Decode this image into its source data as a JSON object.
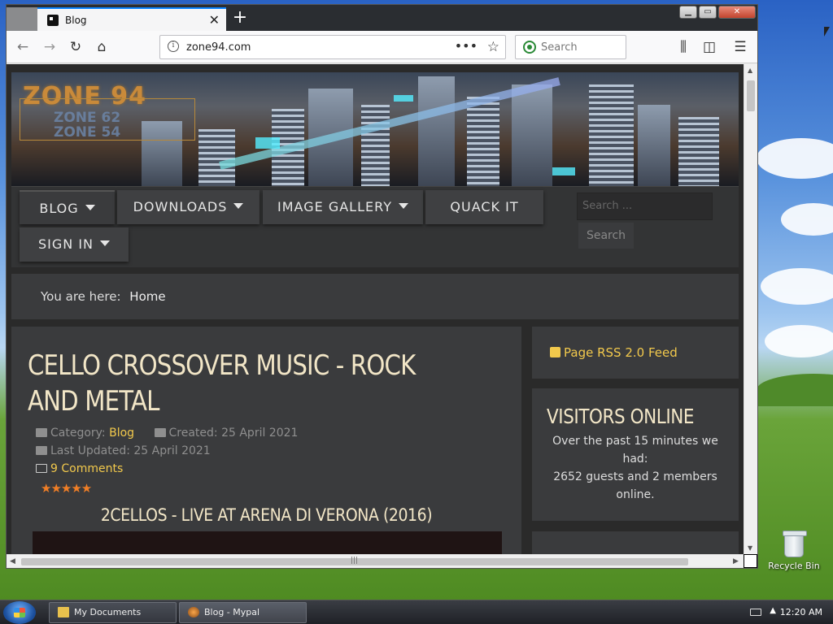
{
  "browser": {
    "tab_title": "Blog",
    "url": "zone94.com",
    "search_placeholder": "Search"
  },
  "site": {
    "logo_main": "ZONE 94",
    "logo_sub1": "ZONE 62",
    "logo_sub2": "ZONE 54",
    "menu": [
      {
        "label": "BLOG"
      },
      {
        "label": "DOWNLOADS"
      },
      {
        "label": "IMAGE GALLERY"
      },
      {
        "label": "QUACK IT"
      },
      {
        "label": "SIGN IN"
      }
    ],
    "search_placeholder": "Search ...",
    "search_button": "Search",
    "breadcrumb_prefix": "You are here:",
    "breadcrumb_home": "Home"
  },
  "article": {
    "title": "CELLO CROSSOVER MUSIC - ROCK AND METAL",
    "category_label": "Category:",
    "category": "Blog",
    "created": "Created: 25 April 2021",
    "updated": "Last Updated: 25 April 2021",
    "comments": "9 Comments",
    "rating": 5,
    "subtitle": "2CELLOS - LIVE AT ARENA DI VERONA (2016)"
  },
  "sidebar": {
    "rss": "Page RSS 2.0 Feed",
    "visitors_title": "VISITORS ONLINE",
    "visitors_text": "Over the past 15 minutes we had:\n2652 guests and 2 members online."
  },
  "desktop": {
    "recycle_label": "Recycle Bin"
  },
  "taskbar": {
    "items": [
      {
        "label": "My Documents"
      },
      {
        "label": "Blog - Mypal"
      }
    ],
    "clock": "12:20 AM"
  }
}
